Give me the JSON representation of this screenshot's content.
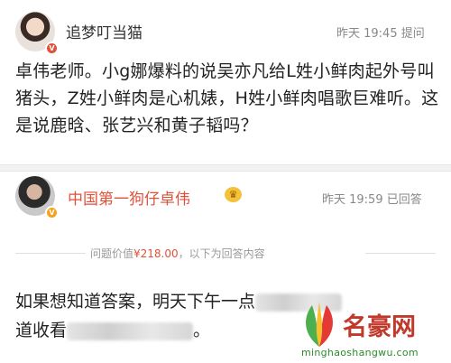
{
  "question": {
    "username": "追梦叮当猫",
    "meta": "昨天 19:45 提问",
    "content": "卓伟老师。小g娜爆料的说吴亦凡给L姓小鲜肉起外号叫猪头，Z姓小鲜肉是心机婊，H姓小鲜肉唱歌巨难听。这是说鹿晗、张艺兴和黄子韬吗？"
  },
  "answer": {
    "username": "中国第一狗仔卓伟",
    "meta": "昨天 19:59 已回答",
    "price_prefix": "问题价值",
    "price_value": "¥218.00",
    "price_suffix": "，以下为回答内容",
    "content_part1": "如果想知道答案，明天下午一点",
    "content_part2": "道收看",
    "content_part3": "。"
  },
  "watermark": {
    "brand": "名豪网",
    "domain": "minghaoshangwu.com"
  },
  "colors": {
    "accent": "#e2503a",
    "gold": "#f7a11a",
    "muted": "#888888"
  }
}
